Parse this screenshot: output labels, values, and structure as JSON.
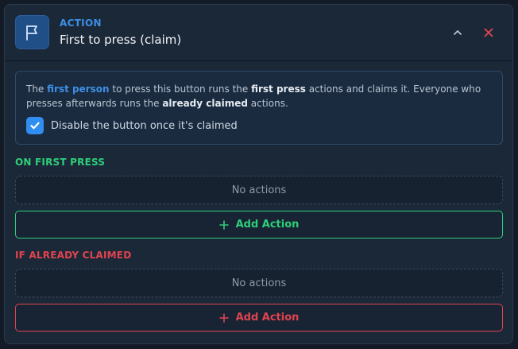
{
  "header": {
    "kicker": "ACTION",
    "title": "First to press (claim)",
    "icon": "flag-icon",
    "collapse_icon": "chevron-up-icon",
    "close_icon": "close-icon"
  },
  "info": {
    "t1": "The ",
    "h1": "first person",
    "t2": " to press this button runs the ",
    "b1": "first press",
    "t3": " actions and claims it. Everyone who presses afterwards runs the ",
    "b2": "already claimed",
    "t4": " actions.",
    "checkbox_label": "Disable the button once it's claimed",
    "checkbox_checked": true
  },
  "sections": {
    "first_press": {
      "title": "ON FIRST PRESS",
      "empty_text": "No actions",
      "add_label": "Add Action"
    },
    "already_claimed": {
      "title": "IF ALREADY CLAIMED",
      "empty_text": "No actions",
      "add_label": "Add Action"
    }
  },
  "colors": {
    "accent_blue": "#3d8fe6",
    "success_green": "#2ecf7a",
    "danger_red": "#e0444f"
  }
}
